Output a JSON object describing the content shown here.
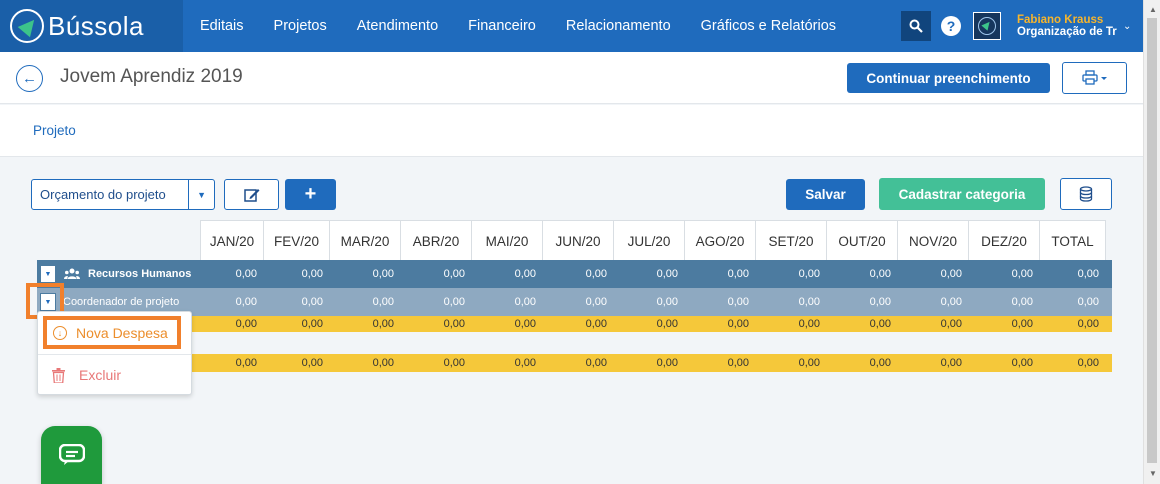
{
  "app": {
    "name": "Bússola"
  },
  "nav": {
    "items": [
      "Editais",
      "Projetos",
      "Atendimento",
      "Financeiro",
      "Relacionamento",
      "Gráficos e Relatórios"
    ]
  },
  "user": {
    "name": "Fabiano Krauss",
    "org": "Organização de Tre"
  },
  "header": {
    "title": "Jovem Aprendiz 2019",
    "continue_label": "Continuar preenchimento"
  },
  "breadcrumb": "Projeto",
  "toolbar": {
    "budget_select": "Orçamento do projeto",
    "add_label": "+",
    "save_label": "Salvar",
    "category_label": "Cadastrar categoria"
  },
  "table": {
    "months": [
      "JAN/20",
      "FEV/20",
      "MAR/20",
      "ABR/20",
      "MAI/20",
      "JUN/20",
      "JUL/20",
      "AGO/20",
      "SET/20",
      "OUT/20",
      "NOV/20",
      "DEZ/20"
    ],
    "total_header": "TOTAL",
    "category": {
      "label": "Recursos Humanos",
      "values": [
        "0,00",
        "0,00",
        "0,00",
        "0,00",
        "0,00",
        "0,00",
        "0,00",
        "0,00",
        "0,00",
        "0,00",
        "0,00",
        "0,00",
        "0,00"
      ]
    },
    "subcategory": {
      "label": "Coordenador de projeto",
      "values": [
        "0,00",
        "0,00",
        "0,00",
        "0,00",
        "0,00",
        "0,00",
        "0,00",
        "0,00",
        "0,00",
        "0,00",
        "0,00",
        "0,00",
        "0,00"
      ]
    },
    "yellow_rows": [
      {
        "values": [
          "0,00",
          "0,00",
          "0,00",
          "0,00",
          "0,00",
          "0,00",
          "0,00",
          "0,00",
          "0,00",
          "0,00",
          "0,00",
          "0,00",
          "0,00"
        ]
      },
      {
        "values": [
          "0,00",
          "0,00",
          "0,00",
          "0,00",
          "0,00",
          "0,00",
          "0,00",
          "0,00",
          "0,00",
          "0,00",
          "0,00",
          "0,00",
          "0,00"
        ]
      }
    ]
  },
  "menu": {
    "new_expense": "Nova Despesa",
    "delete": "Excluir"
  },
  "colors": {
    "primary": "#1f6bbd",
    "green": "#43c097",
    "highlight": "#f1802c",
    "row_category": "#4c7ba0",
    "row_sub": "#8ea9c1",
    "row_total": "#f5c83a"
  }
}
